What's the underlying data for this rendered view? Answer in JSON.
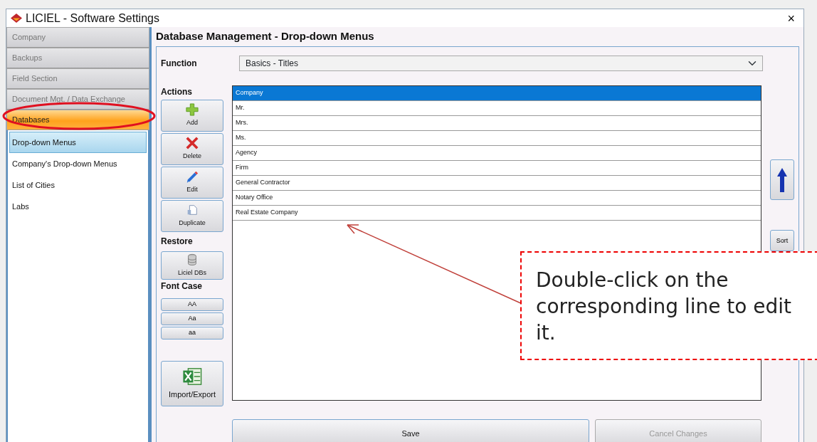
{
  "window": {
    "title": "LICIEL - Software Settings",
    "close": "×"
  },
  "sidebar": {
    "sections": [
      {
        "label": "Company",
        "selected": false
      },
      {
        "label": "Backups",
        "selected": false
      },
      {
        "label": "Field Section",
        "selected": false
      },
      {
        "label": "Document Mgt. / Data Exchange",
        "selected": false
      },
      {
        "label": "Databases",
        "selected": true
      }
    ],
    "items": [
      {
        "label": "Drop-down Menus",
        "selected": true
      },
      {
        "label": "Company's Drop-down Menus",
        "selected": false
      },
      {
        "label": "List of Cities",
        "selected": false
      },
      {
        "label": "Labs",
        "selected": false
      }
    ]
  },
  "main": {
    "heading": "Database Management - Drop-down Menus",
    "function_label": "Function",
    "function_value": "Basics - Titles",
    "actions_label": "Actions",
    "actions": [
      {
        "kind": "add",
        "label": "Add"
      },
      {
        "kind": "delete",
        "label": "Delete"
      },
      {
        "kind": "edit",
        "label": "Edit"
      },
      {
        "kind": "duplicate",
        "label": "Duplicate"
      }
    ],
    "restore_label": "Restore",
    "restore": [
      {
        "kind": "database",
        "label": "Liciel DBs"
      }
    ],
    "font_case_label": "Font Case",
    "font_case": [
      "AA",
      "Aa",
      "aa"
    ],
    "import_export": {
      "kind": "spreadsheet",
      "label": "Import/Export"
    },
    "list": [
      {
        "label": "Company",
        "selected": true
      },
      {
        "label": "Mr.",
        "selected": false
      },
      {
        "label": "Mrs.",
        "selected": false
      },
      {
        "label": "Ms.",
        "selected": false
      },
      {
        "label": "Agency",
        "selected": false
      },
      {
        "label": "Firm",
        "selected": false
      },
      {
        "label": "General Contractor",
        "selected": false
      },
      {
        "label": "Notary Office",
        "selected": false
      },
      {
        "label": "Real Estate Company",
        "selected": false
      }
    ],
    "sort": "Sort",
    "buttons": [
      {
        "label": "Save",
        "disabled": false
      },
      {
        "label": "Cancel Changes",
        "disabled": true
      }
    ]
  },
  "annotation": {
    "text": "Double-click on the corresponding line to edit it."
  }
}
